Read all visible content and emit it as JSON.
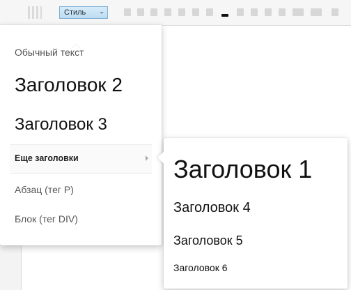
{
  "toolbar": {
    "style_select_value": "Стиль"
  },
  "menu": {
    "items": [
      {
        "label": "Обычный текст"
      },
      {
        "label": "Заголовок 2"
      },
      {
        "label": "Заголовок 3"
      },
      {
        "label": "Еще заголовки"
      },
      {
        "label": "Абзац (тег P)"
      },
      {
        "label": "Блок (тег DIV)"
      }
    ]
  },
  "submenu": {
    "items": [
      {
        "label": "Заголовок 1"
      },
      {
        "label": "Заголовок 4"
      },
      {
        "label": "Заголовок 5"
      },
      {
        "label": "Заголовок 6"
      }
    ]
  }
}
